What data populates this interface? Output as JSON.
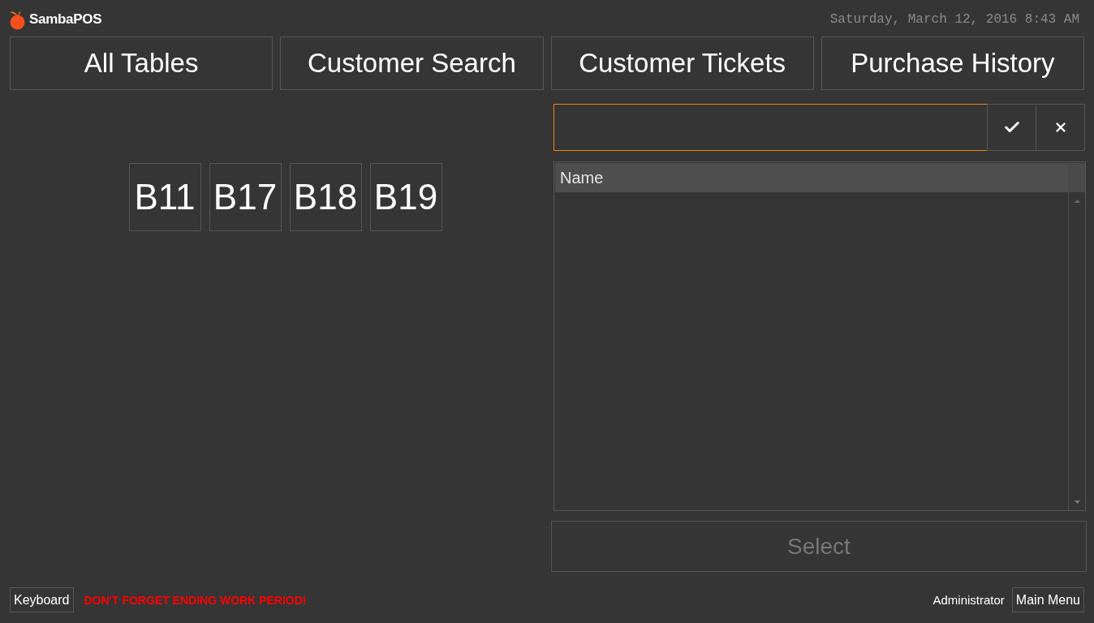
{
  "header": {
    "app_name": "SambaPOS",
    "datetime": "Saturday, March 12, 2016 8:43 AM"
  },
  "nav_buttons": [
    {
      "label": "All Tables"
    },
    {
      "label": "Customer Search"
    },
    {
      "label": "Customer Tickets"
    },
    {
      "label": "Purchase History"
    }
  ],
  "tables": [
    {
      "label": "B11"
    },
    {
      "label": "B17"
    },
    {
      "label": "B18"
    },
    {
      "label": "B19"
    }
  ],
  "search": {
    "focused": true
  },
  "entity_list": {
    "columns": [
      "Name"
    ]
  },
  "select_button": {
    "label": "Select",
    "disabled": true
  },
  "footer": {
    "keyboard_button": "Keyboard",
    "warning": "DON'T FORGET ENDING WORK PERIOD!",
    "user": "Administrator",
    "main_menu_button": "Main Menu"
  }
}
